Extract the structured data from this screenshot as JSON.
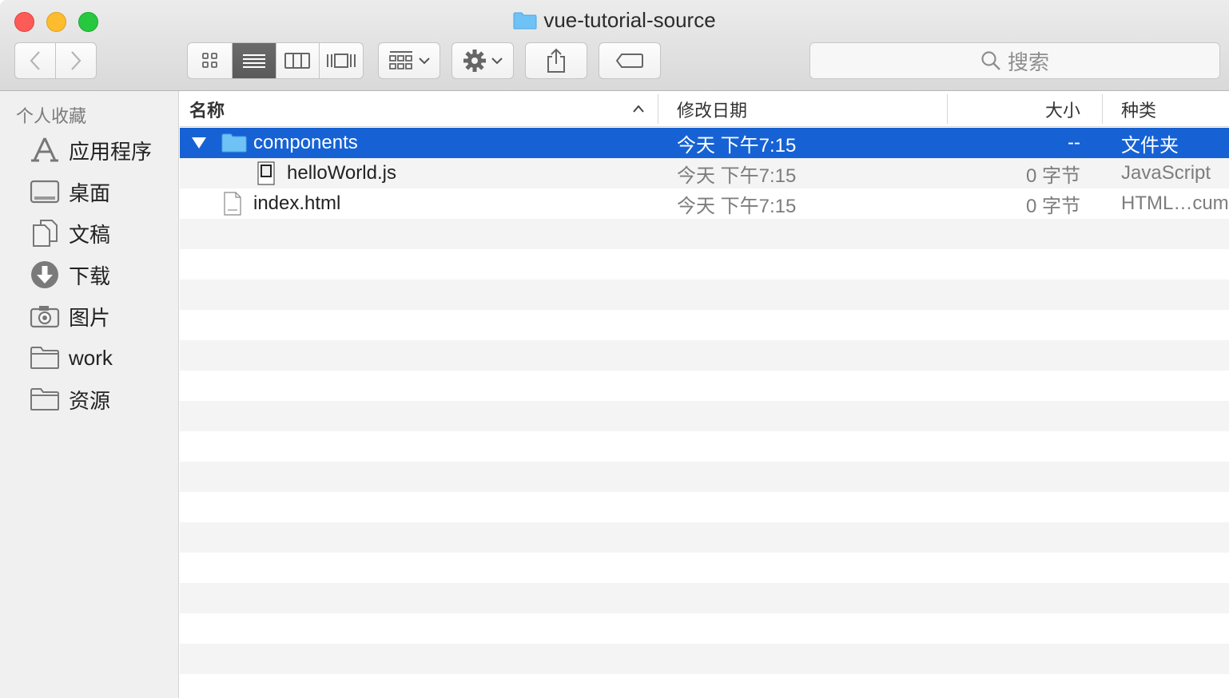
{
  "window": {
    "title": "vue-tutorial-source"
  },
  "toolbar": {
    "back_icon": "chevron-left-icon",
    "forward_icon": "chevron-right-icon",
    "view_modes": [
      "icon-view",
      "list-view",
      "column-view",
      "cover-flow-view"
    ],
    "active_view": "list-view",
    "search_placeholder": "搜索"
  },
  "sidebar": {
    "section_title": "个人收藏",
    "items": [
      {
        "label": "应用程序",
        "icon": "applications-icon"
      },
      {
        "label": "桌面",
        "icon": "desktop-icon"
      },
      {
        "label": "文稿",
        "icon": "documents-icon"
      },
      {
        "label": "下载",
        "icon": "downloads-icon"
      },
      {
        "label": "图片",
        "icon": "pictures-icon"
      },
      {
        "label": "work",
        "icon": "folder-icon"
      },
      {
        "label": "资源",
        "icon": "folder-icon"
      }
    ]
  },
  "list": {
    "columns": {
      "name": "名称",
      "modified": "修改日期",
      "size": "大小",
      "kind": "种类"
    },
    "sort_icon": "chevron-up-icon",
    "rows": [
      {
        "name": "components",
        "modified": "今天 下午7:15",
        "size": "--",
        "kind": "文件夹",
        "selected": true,
        "expanded": true,
        "type": "folder",
        "indent": 0
      },
      {
        "name": "helloWorld.js",
        "modified": "今天 下午7:15",
        "size": "0 字节",
        "kind": "JavaScript",
        "selected": false,
        "type": "js-file",
        "indent": 1
      },
      {
        "name": "index.html",
        "modified": "今天 下午7:15",
        "size": "0 字节",
        "kind": "HTML…cum",
        "selected": false,
        "type": "html-file",
        "indent": 0
      }
    ]
  },
  "colors": {
    "selection": "#1662d4",
    "folder_blue": "#5cb8f2",
    "stripe": "#f4f4f4"
  }
}
